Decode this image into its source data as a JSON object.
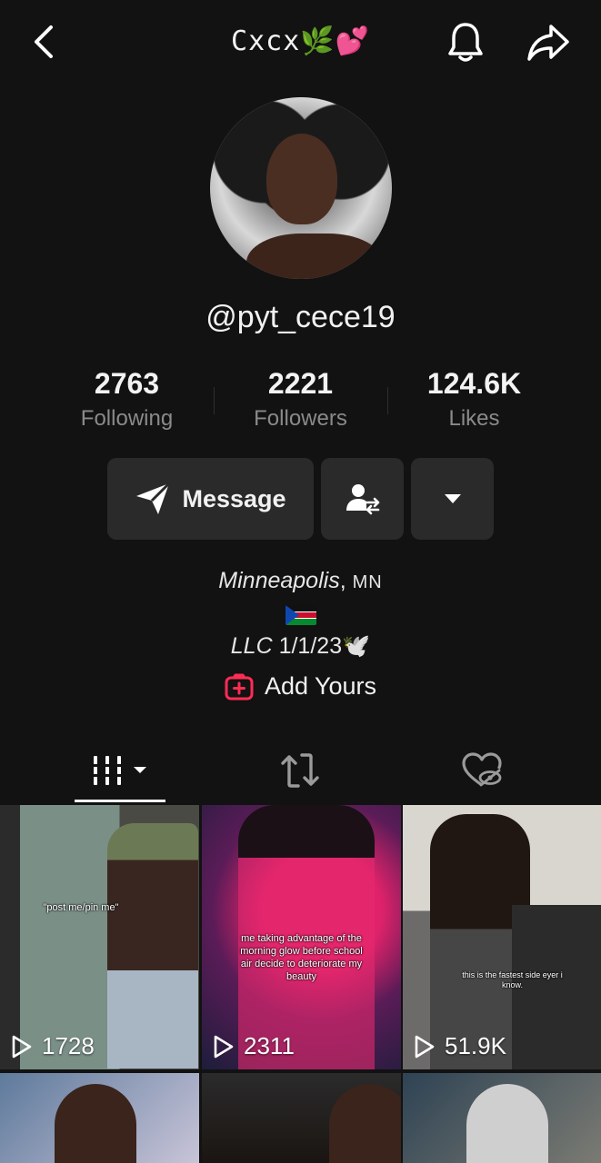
{
  "header": {
    "title": "Cxcx🌿💕"
  },
  "profile": {
    "username": "@pyt_cece19",
    "stats": [
      {
        "value": "2763",
        "label": "Following"
      },
      {
        "value": "2221",
        "label": "Followers"
      },
      {
        "value": "124.6K",
        "label": "Likes"
      }
    ],
    "actions": {
      "message_label": "Message"
    },
    "bio": {
      "city": "Minneapolis",
      "separator": ", ",
      "state": "MN",
      "line3_prefix": "LLC",
      "line3_date": " 1/1/23",
      "line3_emoji": "🕊️"
    },
    "add_yours_label": "Add Yours"
  },
  "videos": [
    {
      "caption": "\"post me/pin me\"",
      "views": "1728"
    },
    {
      "caption": "me taking advantage of the morning glow before school air decide to deteriorate my beauty",
      "views": "2311"
    },
    {
      "caption": "this is the fastest side eyer i know.",
      "views": "51.9K"
    },
    {
      "caption": "",
      "views": ""
    },
    {
      "caption": "",
      "views": ""
    },
    {
      "caption": "",
      "views": ""
    }
  ],
  "icons": {
    "back": "chevron-left-icon",
    "notifications": "bell-icon",
    "share": "share-arrow-icon",
    "message": "paper-plane-icon",
    "friend": "user-swap-icon",
    "more": "caret-down-icon",
    "add_yours": "plus-square-icon",
    "tab_videos": "grid-bars-icon",
    "tab_reposts": "repost-icon",
    "tab_liked": "hidden-heart-icon",
    "play": "play-outline-icon"
  },
  "colors": {
    "background": "#121212",
    "button": "#2a2a2a",
    "accent": "#fe2c55",
    "muted_text": "#8a8a8a"
  }
}
